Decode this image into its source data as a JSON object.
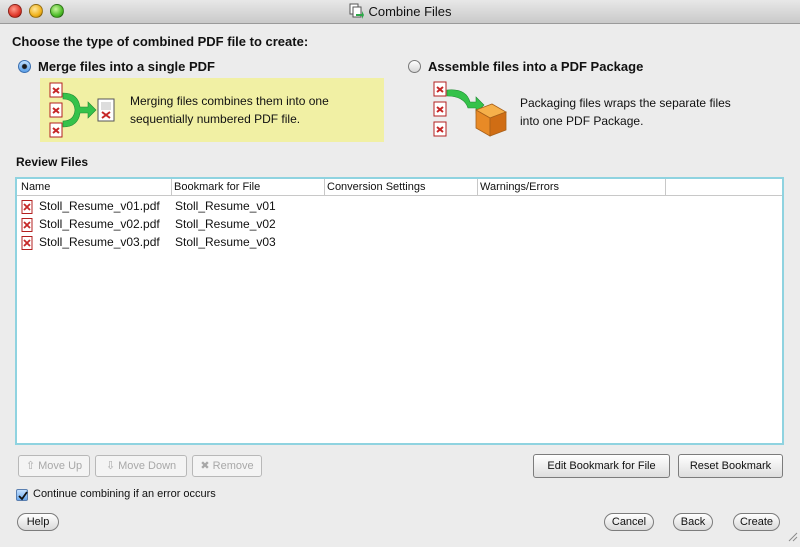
{
  "window": {
    "title": "Combine Files"
  },
  "heading": "Choose the type of combined PDF file to create:",
  "options": {
    "merge": {
      "label": "Merge files into a single PDF",
      "desc_line1": "Merging files combines them into one",
      "desc_line2": "sequentially numbered PDF file.",
      "selected": true,
      "highlight_color": "#f1f0a4"
    },
    "package": {
      "label": "Assemble files into a PDF Package",
      "desc_line1": "Packaging files wraps the separate files",
      "desc_line2": "into one PDF Package.",
      "selected": false
    }
  },
  "review": {
    "label": "Review Files",
    "columns": [
      "Name",
      "Bookmark for File",
      "Conversion Settings",
      "Warnings/Errors"
    ],
    "rows": [
      {
        "name": "Stoll_Resume_v01.pdf",
        "bookmark": "Stoll_Resume_v01"
      },
      {
        "name": "Stoll_Resume_v02.pdf",
        "bookmark": "Stoll_Resume_v02"
      },
      {
        "name": "Stoll_Resume_v03.pdf",
        "bookmark": "Stoll_Resume_v03"
      }
    ],
    "border_color": "#8fd3e0"
  },
  "list_buttons": {
    "move_up": "Move Up",
    "move_down": "Move Down",
    "remove": "Remove",
    "edit_bookmark": "Edit Bookmark for File",
    "reset_bookmark": "Reset Bookmark"
  },
  "continue_checkbox": {
    "label": "Continue combining if an error occurs",
    "checked": true
  },
  "footer": {
    "help": "Help",
    "cancel": "Cancel",
    "back": "Back",
    "create": "Create"
  },
  "icons": {
    "title": "combine-files-icon",
    "pdf": "pdf-file-icon",
    "merge": "merge-arrow-icon",
    "package": "package-box-icon"
  }
}
